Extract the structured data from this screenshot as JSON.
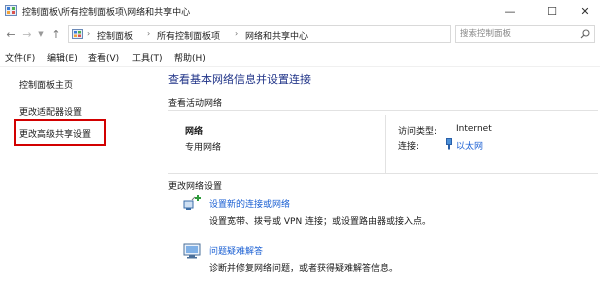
{
  "window": {
    "title": "控制面板\\所有控制面板项\\网络和共享中心",
    "min_symbol": "—",
    "max_symbol": "☐",
    "close_symbol": "✕"
  },
  "address": {
    "crumbs": [
      "控制面板",
      "所有控制面板项",
      "网络和共享中心"
    ],
    "separator": "›",
    "search_placeholder": "搜索控制面板"
  },
  "menu": [
    "文件(F)",
    "编辑(E)",
    "查看(V)",
    "工具(T)",
    "帮助(H)"
  ],
  "sidebar": {
    "items": [
      {
        "label": "控制面板主页"
      },
      {
        "label": "更改适配器设置"
      },
      {
        "label": "更改高级共享设置"
      }
    ]
  },
  "main": {
    "title": "查看基本网络信息并设置连接",
    "active_networks_heading": "查看活动网络",
    "network": {
      "name": "网络",
      "category": "专用网络",
      "access_type_label": "访问类型:",
      "access_type_value": "Internet",
      "connection_label": "连接:",
      "connection_value": "以太网"
    },
    "change_heading": "更改网络设置",
    "tasks": [
      {
        "icon": "new-connection-icon",
        "label": "设置新的连接或网络",
        "desc": "设置宽带、拨号或 VPN 连接；或设置路由器或接入点。"
      },
      {
        "icon": "troubleshoot-icon",
        "label": "问题疑难解答",
        "desc": "诊断并修复网络问题，或者获得疑难解答信息。"
      }
    ]
  },
  "colors": {
    "title_blue": "#1e3287",
    "link_blue": "#1a5fd3",
    "highlight_red": "#d20000"
  }
}
